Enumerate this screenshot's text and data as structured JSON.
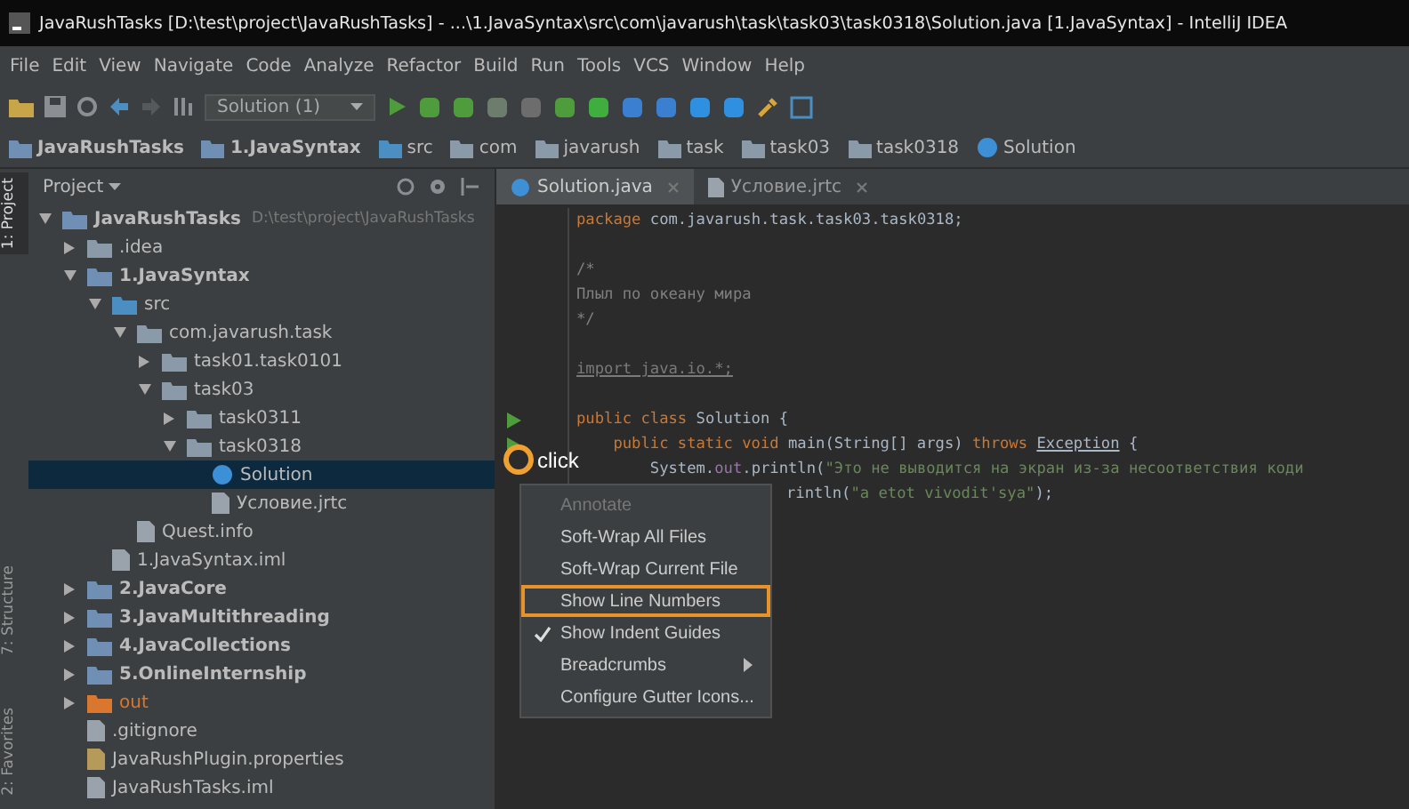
{
  "window": {
    "title": "JavaRushTasks [D:\\test\\project\\JavaRushTasks] - ...\\1.JavaSyntax\\src\\com\\javarush\\task\\task03\\task0318\\Solution.java [1.JavaSyntax] - IntelliJ IDEA"
  },
  "menu": [
    "File",
    "Edit",
    "View",
    "Navigate",
    "Code",
    "Analyze",
    "Refactor",
    "Build",
    "Run",
    "Tools",
    "VCS",
    "Window",
    "Help"
  ],
  "toolbar": {
    "run_config": "Solution (1)"
  },
  "breadcrumbs": [
    {
      "label": "JavaRushTasks",
      "kind": "module"
    },
    {
      "label": "1.JavaSyntax",
      "kind": "module"
    },
    {
      "label": "src",
      "kind": "source"
    },
    {
      "label": "com",
      "kind": "folder"
    },
    {
      "label": "javarush",
      "kind": "folder"
    },
    {
      "label": "task",
      "kind": "folder"
    },
    {
      "label": "task03",
      "kind": "folder"
    },
    {
      "label": "task0318",
      "kind": "folder"
    },
    {
      "label": "Solution",
      "kind": "class"
    }
  ],
  "side_tabs": [
    {
      "label": "1: Project",
      "selected": true
    },
    {
      "label": "7: Structure",
      "selected": false
    },
    {
      "label": "2: Favorites",
      "selected": false
    }
  ],
  "project_panel": {
    "title": "Project",
    "tree": [
      {
        "label": "JavaRushTasks",
        "path": "D:\\test\\project\\JavaRushTasks",
        "kind": "module",
        "expanded": true,
        "selected": false,
        "children": [
          {
            "label": ".idea",
            "kind": "folder",
            "expanded": false,
            "selected": false
          },
          {
            "label": "1.JavaSyntax",
            "kind": "module",
            "expanded": true,
            "selected": false,
            "children": [
              {
                "label": "src",
                "kind": "source",
                "expanded": true,
                "selected": false,
                "children": [
                  {
                    "label": "com.javarush.task",
                    "kind": "folder",
                    "expanded": true,
                    "selected": false,
                    "children": [
                      {
                        "label": "task01.task0101",
                        "kind": "folder",
                        "expanded": false,
                        "selected": false
                      },
                      {
                        "label": "task03",
                        "kind": "folder",
                        "expanded": true,
                        "selected": false,
                        "children": [
                          {
                            "label": "task0311",
                            "kind": "folder",
                            "expanded": false,
                            "selected": false
                          },
                          {
                            "label": "task0318",
                            "kind": "folder",
                            "expanded": true,
                            "selected": false,
                            "children": [
                              {
                                "label": "Solution",
                                "kind": "class",
                                "selected": true
                              },
                              {
                                "label": "Условие.jrtc",
                                "kind": "file",
                                "selected": false
                              }
                            ]
                          }
                        ]
                      }
                    ]
                  },
                  {
                    "label": "Quest.info",
                    "kind": "file",
                    "selected": false
                  }
                ]
              },
              {
                "label": "1.JavaSyntax.iml",
                "kind": "iml",
                "selected": false
              }
            ]
          },
          {
            "label": "2.JavaCore",
            "kind": "module",
            "expanded": false,
            "selected": false
          },
          {
            "label": "3.JavaMultithreading",
            "kind": "module",
            "expanded": false,
            "selected": false
          },
          {
            "label": "4.JavaCollections",
            "kind": "module",
            "expanded": false,
            "selected": false
          },
          {
            "label": "5.OnlineInternship",
            "kind": "module",
            "expanded": false,
            "selected": false
          },
          {
            "label": "out",
            "kind": "excluded",
            "expanded": false,
            "selected": false
          },
          {
            "label": ".gitignore",
            "kind": "file",
            "selected": false
          },
          {
            "label": "JavaRushPlugin.properties",
            "kind": "properties",
            "selected": false
          },
          {
            "label": "JavaRushTasks.iml",
            "kind": "iml",
            "selected": false
          }
        ]
      }
    ]
  },
  "editor": {
    "tabs": [
      {
        "label": "Solution.java",
        "kind": "class",
        "selected": true
      },
      {
        "label": "Условие.jrtc",
        "kind": "file",
        "selected": false
      }
    ],
    "lines": [
      {
        "run": false,
        "segs": [
          {
            "t": "package ",
            "kind": "kw"
          },
          {
            "t": "com.javarush.task.task03.task0318;",
            "kind": "plain"
          }
        ]
      },
      {
        "run": false
      },
      {
        "run": false,
        "segs": [
          {
            "t": "/*",
            "kind": "comment"
          }
        ]
      },
      {
        "run": false,
        "segs": [
          {
            "t": "Плыл по океану мира",
            "kind": "comment"
          }
        ]
      },
      {
        "run": false,
        "segs": [
          {
            "t": "*/",
            "kind": "comment"
          }
        ]
      },
      {
        "run": false
      },
      {
        "run": false,
        "segs": [
          {
            "t": "import java.io.*;",
            "kind": "unused"
          }
        ]
      },
      {
        "run": false
      },
      {
        "run": true,
        "segs": [
          {
            "t": "public class ",
            "kind": "kw"
          },
          {
            "t": "Solution {",
            "kind": "plain"
          }
        ]
      },
      {
        "run": true,
        "segs": [
          {
            "t": "    public static void ",
            "kind": "kw"
          },
          {
            "t": "main(String[] args) ",
            "kind": "plain"
          },
          {
            "t": "throws ",
            "kind": "kw"
          },
          {
            "t": "Exception",
            "kind": "link"
          },
          {
            "t": " {",
            "kind": "plain"
          }
        ]
      },
      {
        "run": false,
        "segs": [
          {
            "t": "        System.",
            "kind": "plain"
          },
          {
            "t": "out",
            "kind": "field"
          },
          {
            "t": ".println(",
            "kind": "plain"
          },
          {
            "t": "\"Это не выводится на экран из-за несоответствия коди",
            "kind": "string"
          }
        ]
      },
      {
        "run": false,
        "segs": [
          {
            "t": "rintln(",
            "kind": "plain"
          },
          {
            "t": "\"a etot vivodit'sya\"",
            "kind": "string"
          },
          {
            "t": ");",
            "kind": "plain"
          }
        ]
      }
    ]
  },
  "context_menu": {
    "items": [
      {
        "label": "Annotate",
        "disabled": true,
        "checked": false,
        "submenu": false,
        "highlighted": false
      },
      {
        "label": "Soft-Wrap All Files",
        "disabled": false,
        "checked": false,
        "submenu": false,
        "highlighted": false
      },
      {
        "label": "Soft-Wrap Current File",
        "disabled": false,
        "checked": false,
        "submenu": false,
        "highlighted": false
      },
      {
        "label": "Show Line Numbers",
        "disabled": false,
        "checked": false,
        "submenu": false,
        "highlighted": true
      },
      {
        "label": "Show Indent Guides",
        "disabled": false,
        "checked": true,
        "submenu": false,
        "highlighted": false
      },
      {
        "label": "Breadcrumbs",
        "disabled": false,
        "checked": false,
        "submenu": true,
        "highlighted": false
      },
      {
        "label": "Configure Gutter Icons...",
        "disabled": false,
        "checked": false,
        "submenu": false,
        "highlighted": false
      }
    ]
  },
  "click_hint": {
    "label": "click"
  }
}
